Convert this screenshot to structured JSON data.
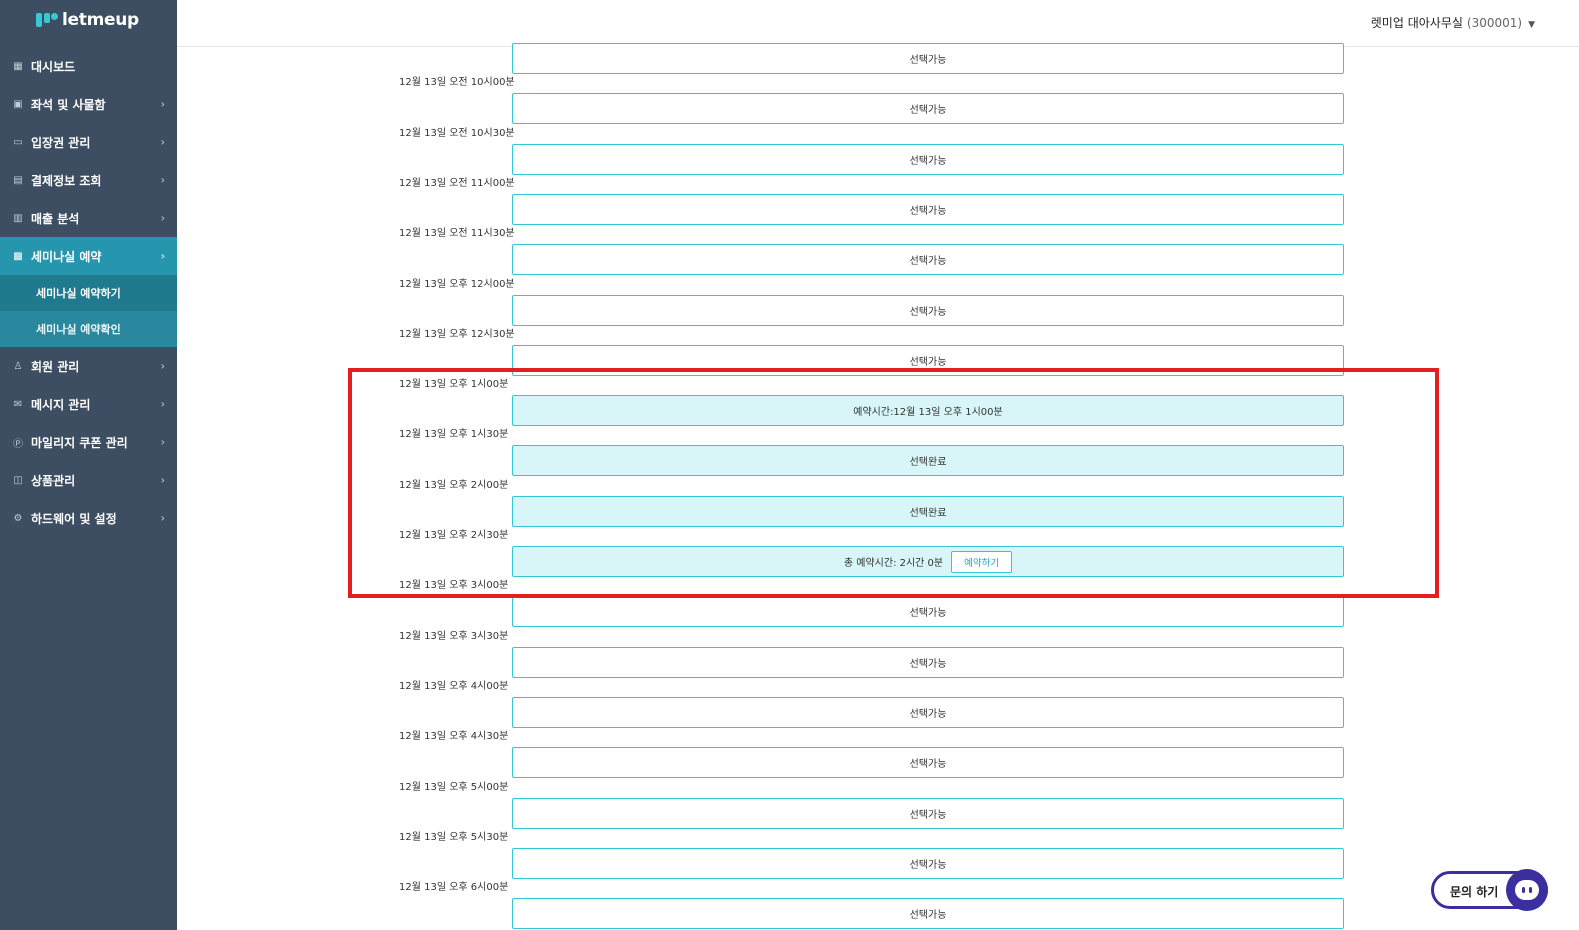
{
  "app": {
    "logo_text": "letmeup"
  },
  "header": {
    "account_name": "렛미업 대아사무실",
    "account_code": "(300001)"
  },
  "sidebar": {
    "items": [
      {
        "label": "대시보드",
        "icon": "dashboard-icon",
        "glyph": "▦",
        "chevron": false
      },
      {
        "label": "좌석 및 사물함",
        "icon": "seat-icon",
        "glyph": "▣",
        "chevron": true
      },
      {
        "label": "입장권 관리",
        "icon": "ticket-icon",
        "glyph": "▭",
        "chevron": true
      },
      {
        "label": "결제정보 조회",
        "icon": "card-icon",
        "glyph": "▤",
        "chevron": true
      },
      {
        "label": "매출 분석",
        "icon": "chart-icon",
        "glyph": "▥",
        "chevron": true
      },
      {
        "label": "세미나실 예약",
        "icon": "calendar-icon",
        "glyph": "▩",
        "chevron": true,
        "active": true
      },
      {
        "label": "회원 관리",
        "icon": "members-icon",
        "glyph": "♙",
        "chevron": true
      },
      {
        "label": "메시지 관리",
        "icon": "mail-icon",
        "glyph": "✉",
        "chevron": true
      },
      {
        "label": "마일리지 쿠폰 관리",
        "icon": "point-icon",
        "glyph": "Ⓟ",
        "chevron": true
      },
      {
        "label": "상품관리",
        "icon": "product-icon",
        "glyph": "◫",
        "chevron": true
      },
      {
        "label": "하드웨어 및 설정",
        "icon": "settings-icon",
        "glyph": "⚙",
        "chevron": true
      }
    ],
    "submenu": [
      {
        "label": "세미나실 예약하기",
        "current": true
      },
      {
        "label": "세미나실 예약확인",
        "current": false
      }
    ]
  },
  "slots": [
    {
      "time": "",
      "status": "선택가능",
      "selected": false
    },
    {
      "time": "12월 13일 오전 10시00분",
      "status": "선택가능",
      "selected": false
    },
    {
      "time": "12월 13일 오전 10시30분",
      "status": "선택가능",
      "selected": false
    },
    {
      "time": "12월 13일 오전 11시00분",
      "status": "선택가능",
      "selected": false
    },
    {
      "time": "12월 13일 오전 11시30분",
      "status": "선택가능",
      "selected": false
    },
    {
      "time": "12월 13일 오후 12시00분",
      "status": "선택가능",
      "selected": false
    },
    {
      "time": "12월 13일 오후 12시30분",
      "status": "선택가능",
      "selected": false
    },
    {
      "time": "12월 13일 오후 1시00분",
      "status": "예약시간:12월 13일 오후 1시00분",
      "selected": true
    },
    {
      "time": "12월 13일 오후 1시30분",
      "status": "선택완료",
      "selected": true
    },
    {
      "time": "12월 13일 오후 2시00분",
      "status": "선택완료",
      "selected": true
    },
    {
      "time": "12월 13일 오후 2시30분",
      "status": "총 예약시간: 2시간 0분",
      "selected": true,
      "button": "예약하기"
    },
    {
      "time": "12월 13일 오후 3시00분",
      "status": "선택가능",
      "selected": false
    },
    {
      "time": "12월 13일 오후 3시30분",
      "status": "선택가능",
      "selected": false
    },
    {
      "time": "12월 13일 오후 4시00분",
      "status": "선택가능",
      "selected": false
    },
    {
      "time": "12월 13일 오후 4시30분",
      "status": "선택가능",
      "selected": false
    },
    {
      "time": "12월 13일 오후 5시00분",
      "status": "선택가능",
      "selected": false
    },
    {
      "time": "12월 13일 오후 5시30분",
      "status": "선택가능",
      "selected": false
    },
    {
      "time": "12월 13일 오후 6시00분",
      "status": "선택가능",
      "selected": false
    }
  ],
  "chat": {
    "label": "문의 하기",
    "icon": "chat-icon"
  },
  "colors": {
    "sidebar": "#3d4e62",
    "accent": "#2596ad",
    "slot_border": "#35c6d6",
    "selected_fill": "#d8f6f7",
    "highlight": "#e41f1f",
    "chat": "#3b2e9e"
  }
}
